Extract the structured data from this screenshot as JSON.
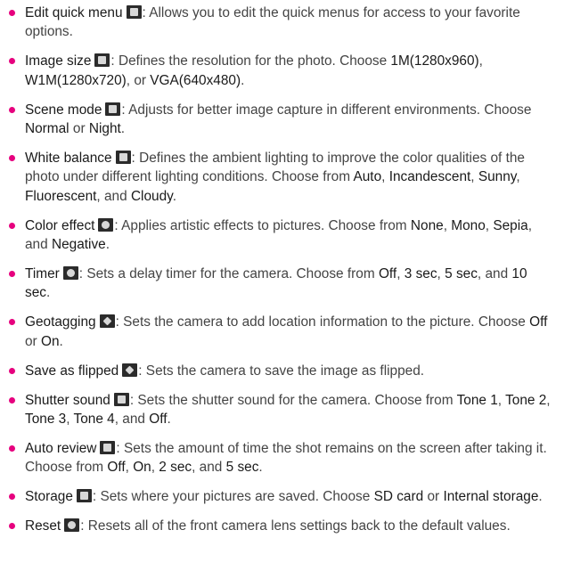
{
  "items": [
    {
      "icon": "edit-quick-menu-icon",
      "segs": [
        [
          "Edit quick menu",
          1
        ],
        [
          ": Allows you to edit the quick menus for access to your favorite options.",
          0
        ]
      ]
    },
    {
      "icon": "image-size-icon",
      "segs": [
        [
          "Image size",
          1
        ],
        [
          ": Defines the resolution for the photo. Choose ",
          0
        ],
        [
          "1M(1280x960)",
          1
        ],
        [
          ", ",
          0
        ],
        [
          "W1M(1280x720)",
          1
        ],
        [
          ", or ",
          0
        ],
        [
          "VGA(640x480)",
          1
        ],
        [
          ".",
          0
        ]
      ]
    },
    {
      "icon": "scene-mode-icon",
      "segs": [
        [
          "Scene mode",
          1
        ],
        [
          ": Adjusts for better image capture in different environments. Choose ",
          0
        ],
        [
          "Normal",
          1
        ],
        [
          " or ",
          0
        ],
        [
          "Night",
          1
        ],
        [
          ".",
          0
        ]
      ]
    },
    {
      "icon": "white-balance-icon",
      "segs": [
        [
          "White balance",
          1
        ],
        [
          ": Defines the ambient lighting to improve the color qualities of the photo under different lighting conditions. Choose from ",
          0
        ],
        [
          "Auto",
          1
        ],
        [
          ", ",
          0
        ],
        [
          "Incandescent",
          1
        ],
        [
          ", ",
          0
        ],
        [
          "Sunny",
          1
        ],
        [
          ", ",
          0
        ],
        [
          "Fluorescent",
          1
        ],
        [
          ", and ",
          0
        ],
        [
          "Cloudy",
          1
        ],
        [
          ".",
          0
        ]
      ]
    },
    {
      "icon": "color-effect-icon",
      "segs": [
        [
          "Color effect",
          1
        ],
        [
          ": Applies artistic effects to pictures. Choose from ",
          0
        ],
        [
          "None",
          1
        ],
        [
          ", ",
          0
        ],
        [
          "Mono",
          1
        ],
        [
          ", ",
          0
        ],
        [
          "Sepia",
          1
        ],
        [
          ", and ",
          0
        ],
        [
          "Negative",
          1
        ],
        [
          ".",
          0
        ]
      ]
    },
    {
      "icon": "timer-icon",
      "segs": [
        [
          "Timer",
          1
        ],
        [
          ": Sets a delay timer for the camera. Choose from ",
          0
        ],
        [
          "Off",
          1
        ],
        [
          ", ",
          0
        ],
        [
          "3 sec",
          1
        ],
        [
          ", ",
          0
        ],
        [
          "5 sec",
          1
        ],
        [
          ", and ",
          0
        ],
        [
          "10 sec",
          1
        ],
        [
          ".",
          0
        ]
      ]
    },
    {
      "icon": "geotagging-icon",
      "segs": [
        [
          "Geotagging",
          1
        ],
        [
          ": Sets the camera to add location information to the picture. Choose ",
          0
        ],
        [
          "Off",
          1
        ],
        [
          " or ",
          0
        ],
        [
          "On",
          1
        ],
        [
          ".",
          0
        ]
      ]
    },
    {
      "icon": "save-as-flipped-icon",
      "segs": [
        [
          "Save as flipped",
          1
        ],
        [
          ": Sets the camera to save the image as flipped.",
          0
        ]
      ]
    },
    {
      "icon": "shutter-sound-icon",
      "segs": [
        [
          "Shutter sound",
          1
        ],
        [
          ": Sets the shutter sound for the camera. Choose from ",
          0
        ],
        [
          "Tone 1",
          1
        ],
        [
          ", ",
          0
        ],
        [
          "Tone 2",
          1
        ],
        [
          ", ",
          0
        ],
        [
          "Tone 3",
          1
        ],
        [
          ", ",
          0
        ],
        [
          "Tone 4",
          1
        ],
        [
          ", and ",
          0
        ],
        [
          "Off",
          1
        ],
        [
          ".",
          0
        ]
      ]
    },
    {
      "icon": "auto-review-icon",
      "segs": [
        [
          "Auto review",
          1
        ],
        [
          ": Sets the amount of time the shot remains on the screen after taking it. Choose from ",
          0
        ],
        [
          "Off",
          1
        ],
        [
          ", ",
          0
        ],
        [
          "On",
          1
        ],
        [
          ", ",
          0
        ],
        [
          "2 sec",
          1
        ],
        [
          ", and ",
          0
        ],
        [
          "5 sec",
          1
        ],
        [
          ".",
          0
        ]
      ]
    },
    {
      "icon": "storage-icon",
      "segs": [
        [
          "Storage",
          1
        ],
        [
          ": Sets where your pictures are saved. Choose ",
          0
        ],
        [
          "SD card",
          1
        ],
        [
          " or ",
          0
        ],
        [
          "Internal storage",
          1
        ],
        [
          ".",
          0
        ]
      ]
    },
    {
      "icon": "reset-icon",
      "segs": [
        [
          "Reset",
          1
        ],
        [
          ": Resets all of the front camera lens settings back to the default values.",
          0
        ]
      ]
    }
  ],
  "colors": {
    "bullet": "#e6007e",
    "text": "#444444",
    "term": "#1a1a1a",
    "icon": "#2b2b2b"
  }
}
